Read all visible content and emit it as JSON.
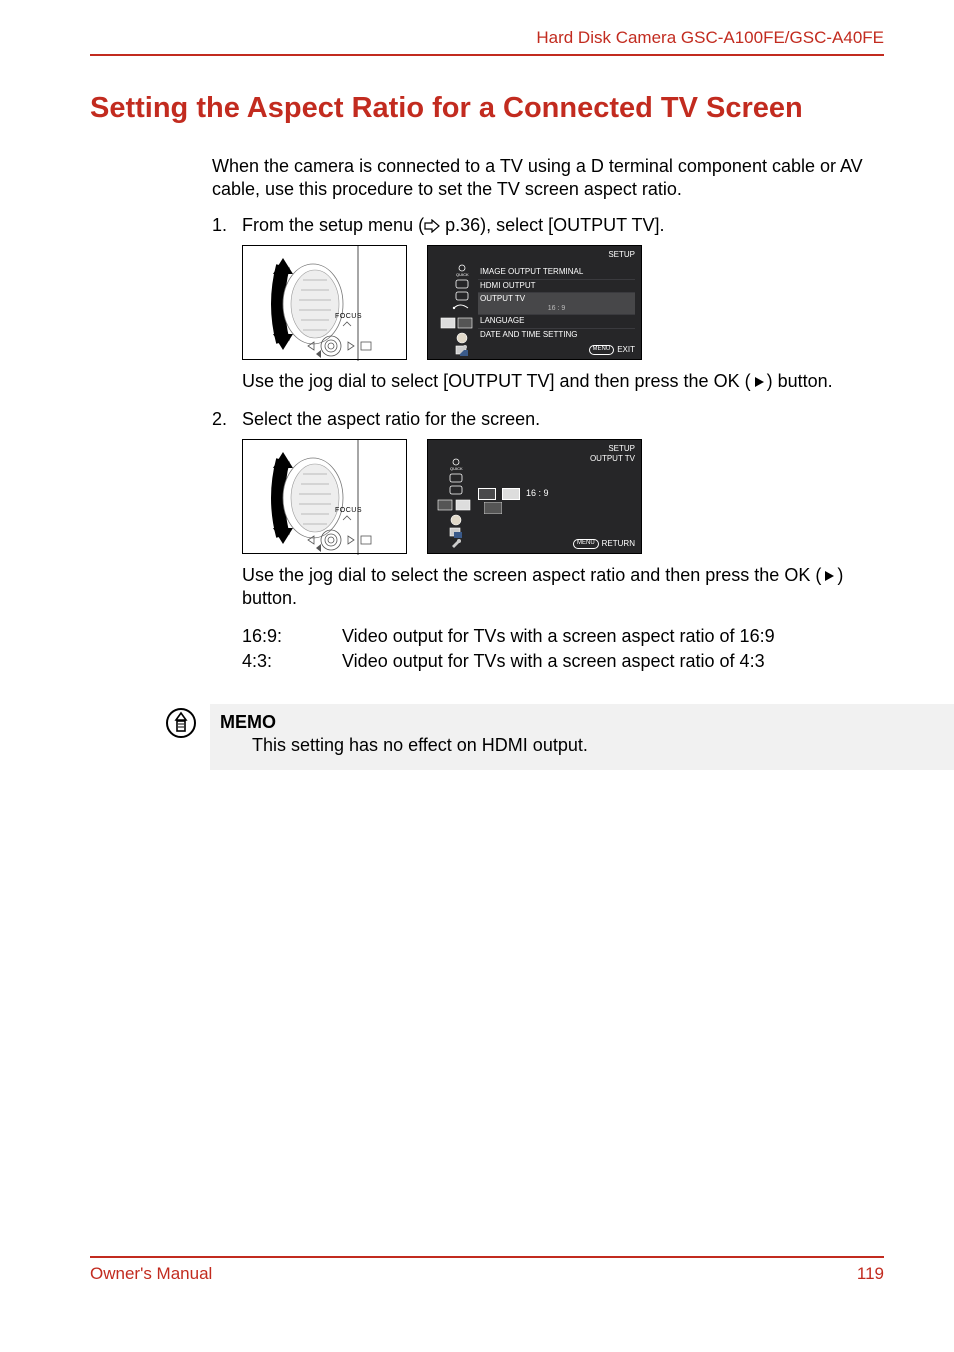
{
  "header": {
    "product": "Hard Disk Camera GSC-A100FE/GSC-A40FE"
  },
  "title": "Setting the Aspect Ratio for a Connected TV Screen",
  "intro": "When the camera is connected to a TV using a D terminal component cable or AV cable, use this procedure to set the TV screen aspect ratio.",
  "steps": {
    "s1_num": "1.",
    "s1_a": "From the setup menu (",
    "s1_b": " p.36), select [OUTPUT TV].",
    "s1_after_a": "Use the jog dial to select [OUTPUT TV] and then press the OK (",
    "s1_after_b": ") button.",
    "s2_num": "2.",
    "s2_text": "Select the aspect ratio for the screen.",
    "s2_after_a": "Use the jog dial to select the screen aspect ratio and then press the OK (",
    "s2_after_b": ") button."
  },
  "dial": {
    "focus": "FOCUS"
  },
  "screen1": {
    "header": "SETUP",
    "items": {
      "i0": "IMAGE OUTPUT TERMINAL",
      "i1": "HDMI OUTPUT",
      "i2": "OUTPUT TV",
      "i2v": "16 : 9",
      "i3": "LANGUAGE",
      "i4": "DATE AND TIME SETTING"
    },
    "exit_pill": "MENU",
    "exit": "EXIT"
  },
  "screen2": {
    "h1": "SETUP",
    "h2": "OUTPUT TV",
    "value": "16 : 9",
    "ret_pill": "MENU",
    "ret": "RETURN"
  },
  "ratios": {
    "k1": "16:9:",
    "v1": "Video output for TVs with a screen aspect ratio of 16:9",
    "k2": "4:3:",
    "v2": "Video output for TVs with a screen aspect ratio of 4:3"
  },
  "memo": {
    "title": "MEMO",
    "body": "This setting has no effect on HDMI output."
  },
  "footer": {
    "left": "Owner's Manual",
    "right": "119"
  }
}
